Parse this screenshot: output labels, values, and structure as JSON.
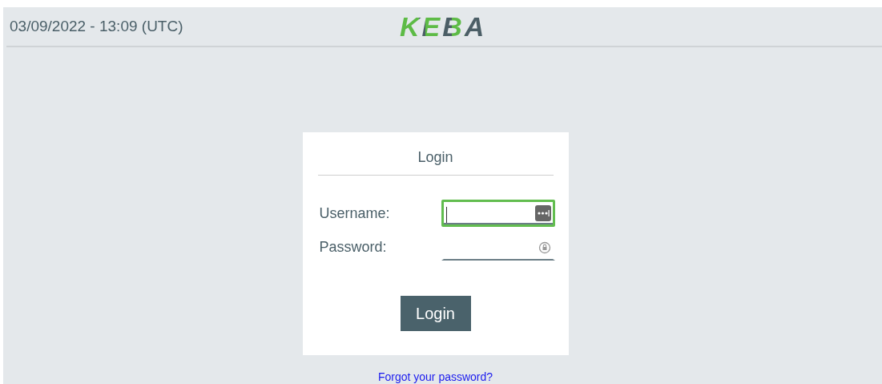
{
  "header": {
    "datetime": "03/09/2022 - 13:09 (UTC)",
    "logo": "KEBA"
  },
  "login": {
    "title": "Login",
    "fields": [
      {
        "label": "Username:",
        "kind": "text",
        "focused": true
      },
      {
        "label": "Password:",
        "kind": "password",
        "focused": false
      }
    ],
    "button": "Login"
  },
  "forgot_link": "Forgot your password?"
}
